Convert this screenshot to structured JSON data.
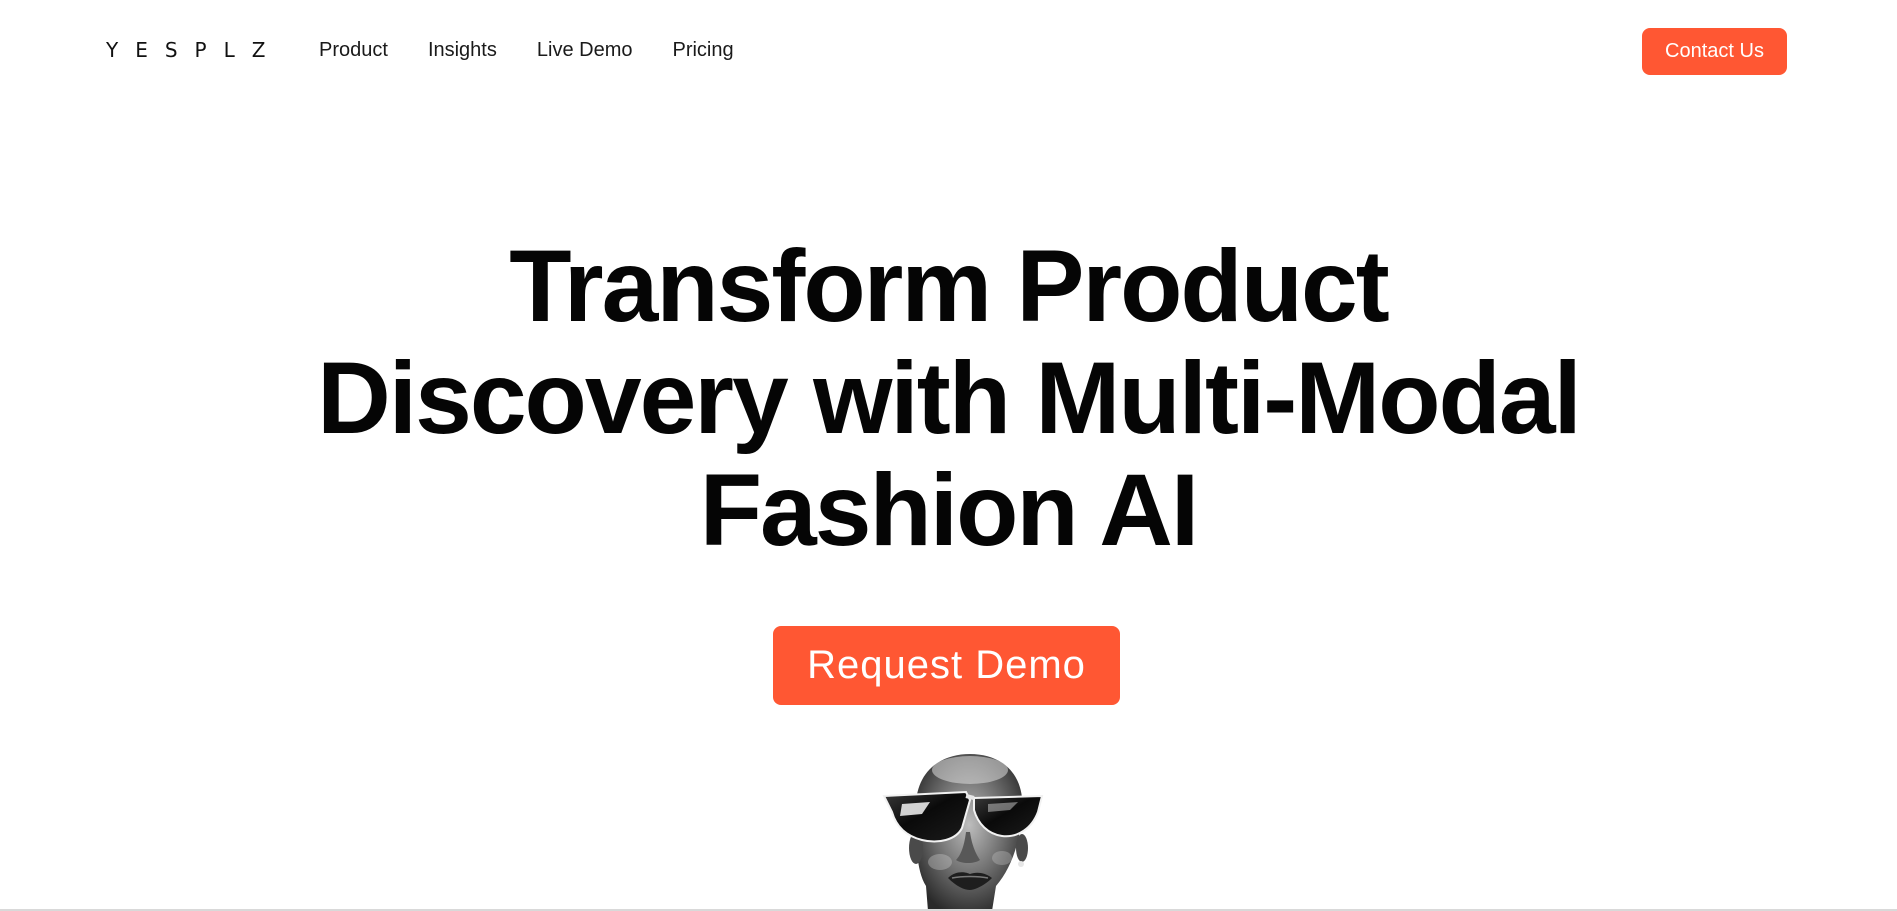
{
  "brand": {
    "logo_text": "YESPLZ",
    "accent_color": "#ff5733"
  },
  "nav": {
    "items": [
      {
        "label": "Product"
      },
      {
        "label": "Insights"
      },
      {
        "label": "Live Demo"
      },
      {
        "label": "Pricing"
      }
    ],
    "contact_label": "Contact Us"
  },
  "hero": {
    "title_lines": [
      "Transform Product",
      "Discovery with Multi-Modal",
      "Fashion AI"
    ],
    "cta_label": "Request Demo",
    "image_icon": "fashion-model-portrait"
  }
}
